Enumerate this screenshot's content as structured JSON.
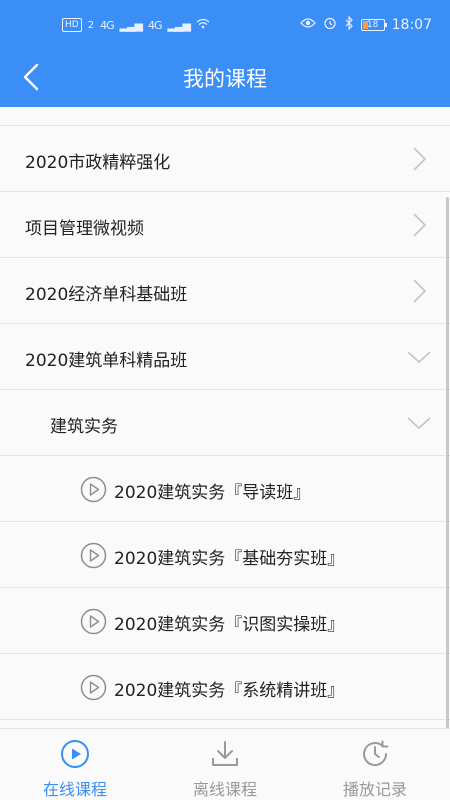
{
  "status_bar": {
    "hd": "HD",
    "hd_sub": "2",
    "signal_1": "4G",
    "signal_2": "4G",
    "battery": "18",
    "time": "18:07"
  },
  "header": {
    "title": "我的课程"
  },
  "courses": [
    {
      "label": "2020市政精粹强化",
      "level": 0,
      "expanded": false
    },
    {
      "label": "项目管理微视频",
      "level": 0,
      "expanded": false
    },
    {
      "label": "2020经济单科基础班",
      "level": 0,
      "expanded": false
    },
    {
      "label": "2020建筑单科精品班",
      "level": 0,
      "expanded": true
    },
    {
      "label": "建筑实务",
      "level": 1,
      "expanded": true
    },
    {
      "label": "2020建筑实务『导读班』",
      "level": 2
    },
    {
      "label": "2020建筑实务『基础夯实班』",
      "level": 2
    },
    {
      "label": "2020建筑实务『识图实操班』",
      "level": 2
    },
    {
      "label": "2020建筑实务『系统精讲班』",
      "level": 2
    }
  ],
  "tabs": [
    {
      "label": "在线课程",
      "icon": "play-circle-icon",
      "active": true
    },
    {
      "label": "离线课程",
      "icon": "download-icon",
      "active": false
    },
    {
      "label": "播放记录",
      "icon": "history-clock-icon",
      "active": false
    }
  ],
  "colors": {
    "brand_blue": "#3a8ef6",
    "tab_inactive": "#999999",
    "divider": "#e6e6e6"
  }
}
